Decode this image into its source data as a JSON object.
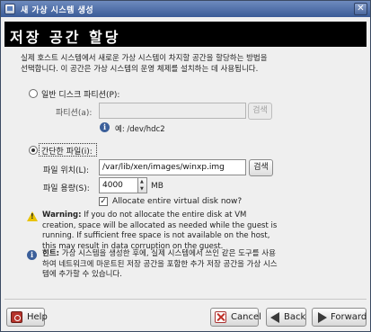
{
  "window": {
    "title": "새 가상 시스템 생성",
    "close_glyph": "✕"
  },
  "banner": {
    "heading": "저장 공간 할당"
  },
  "intro": "실제 호스트 시스템에서 새로운 가상 시스템이 차지할 공간을 할당하는 방법을 선택합니다. 이 공간은 가상 시스템의 운영 체제를 설치하는 데 사용됩니다.",
  "partition": {
    "radio_label": "일반 디스크 파티션(P):",
    "field_label": "파티션(a):",
    "value": "",
    "browse_label": "검색",
    "example": "예: /dev/hdc2",
    "selected": false
  },
  "file": {
    "radio_label": "간단한 파일(i):",
    "location_label": "파일 위치(L):",
    "location_value": "/var/lib/xen/images/winxp.img",
    "browse_label": "검색",
    "size_label": "파일 용량(S):",
    "size_value": "4000",
    "size_unit": "MB",
    "allocate_label": "Allocate entire virtual disk now?",
    "allocate_checked": true,
    "selected": true
  },
  "warning": {
    "title": "Warning:",
    "text": " If you do not allocate the entire disk at VM creation, space will be allocated as needed while the guest is running. If sufficient free space is not available on the host, this may result in data corruption on the guest."
  },
  "tip": {
    "title": "힌트:",
    "text": " 가상 시스템을 생성한 후에, 실제 시스템에서 쓰인 같은 도구를 사용하여 네트워크에 마운트된 저장 공간을 포함한 추가 저장 공간을 가상 시스템에 추가할 수 있습니다."
  },
  "footer": {
    "help": "Help",
    "cancel": "Cancel",
    "back": "Back",
    "forward": "Forward"
  },
  "colors": {
    "titlebar": "#4a6aa5",
    "banner": "#000000",
    "warning": "#e9c300"
  }
}
